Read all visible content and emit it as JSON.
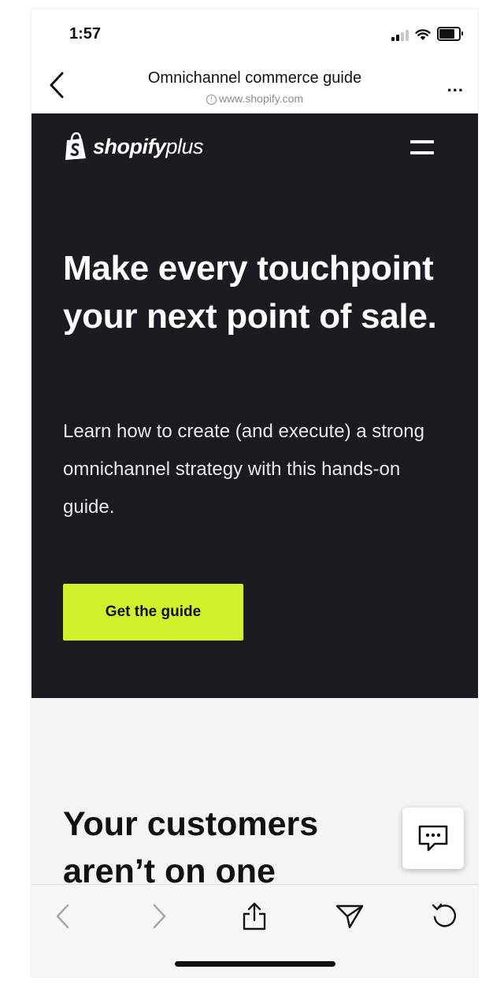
{
  "status_bar": {
    "time": "1:57"
  },
  "browser": {
    "title": "Omnichannel commerce guide",
    "url": "www.shopify.com",
    "more_label": "..."
  },
  "hero": {
    "logo_bold": "shopify",
    "logo_light": "plus",
    "title": "Make every touchpoint your next point of sale.",
    "description": "Learn how to create (and execute) a strong omnichannel strategy with this hands-on guide.",
    "cta_label": "Get the guide"
  },
  "section": {
    "title": "Your customers aren’t on one"
  },
  "colors": {
    "hero_bg": "#1b1b22",
    "accent": "#d3f02c",
    "section_bg": "#f4f4f4"
  },
  "icons": {
    "back": "chevron-left-icon",
    "menu": "hamburger-menu-icon",
    "chat": "chat-bubble-icon",
    "share": "share-icon",
    "send": "send-icon",
    "refresh": "refresh-icon"
  }
}
